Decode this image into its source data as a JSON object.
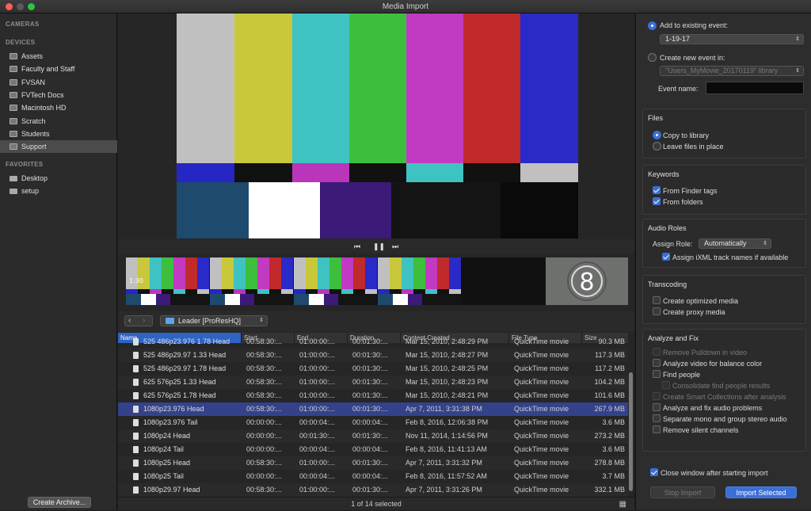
{
  "window": {
    "title": "Media Import"
  },
  "sidebar": {
    "sections": {
      "cameras": "CAMERAS",
      "devices": "DEVICES",
      "favorites": "FAVORITES"
    },
    "devices": [
      {
        "label": "Assets",
        "icon": "drive-icon"
      },
      {
        "label": "Faculty and Staff",
        "icon": "drive-icon"
      },
      {
        "label": "FVSAN",
        "icon": "drive-icon"
      },
      {
        "label": "FVTech Docs",
        "icon": "drive-icon"
      },
      {
        "label": "Macintosh HD",
        "icon": "drive-icon"
      },
      {
        "label": "Scratch",
        "icon": "drive-icon"
      },
      {
        "label": "Students",
        "icon": "drive-icon"
      },
      {
        "label": "Support",
        "icon": "drive-icon",
        "selected": true
      }
    ],
    "favorites": [
      {
        "label": "Desktop",
        "icon": "folder-icon"
      },
      {
        "label": "setup",
        "icon": "folder-icon"
      }
    ],
    "create_archive": "Create Archive..."
  },
  "viewer": {
    "filmstrip_timecode": "1:30",
    "countdown_number": "8"
  },
  "browser": {
    "folder": "Leader [ProResHQ]",
    "columns": [
      "Name",
      "Start",
      "End",
      "Duration",
      "Content Created",
      "File Type",
      "Size"
    ],
    "rows": [
      {
        "name": "525 486p23.976 1.78 Head",
        "start": "00:58:30:...",
        "end": "01:00:00:...",
        "duration": "00:01:30:...",
        "created": "Mar 15, 2010, 2:48:29 PM",
        "type": "QuickTime movie",
        "size": "90.3 MB"
      },
      {
        "name": "525 486p29.97 1.33 Head",
        "start": "00:58:30:...",
        "end": "01:00:00:...",
        "duration": "00:01:30:...",
        "created": "Mar 15, 2010, 2:48:27 PM",
        "type": "QuickTime movie",
        "size": "117.3 MB"
      },
      {
        "name": "525 486p29.97 1.78 Head",
        "start": "00:58:30:...",
        "end": "01:00:00:...",
        "duration": "00:01:30:...",
        "created": "Mar 15, 2010, 2:48:25 PM",
        "type": "QuickTime movie",
        "size": "117.2 MB"
      },
      {
        "name": "625 576p25 1.33 Head",
        "start": "00:58:30:...",
        "end": "01:00:00:...",
        "duration": "00:01:30:...",
        "created": "Mar 15, 2010, 2:48:23 PM",
        "type": "QuickTime movie",
        "size": "104.2 MB"
      },
      {
        "name": "625 576p25 1.78 Head",
        "start": "00:58:30:...",
        "end": "01:00:00:...",
        "duration": "00:01:30:...",
        "created": "Mar 15, 2010, 2:48:21 PM",
        "type": "QuickTime movie",
        "size": "101.6 MB"
      },
      {
        "name": "1080p23.976 Head",
        "start": "00:58:30:...",
        "end": "01:00:00:...",
        "duration": "00:01:30:...",
        "created": "Apr 7, 2011, 3:31:38 PM",
        "type": "QuickTime movie",
        "size": "267.9 MB",
        "selected": true
      },
      {
        "name": "1080p23.976 Tail",
        "start": "00:00:00:...",
        "end": "00:00:04:...",
        "duration": "00:00:04:...",
        "created": "Feb 8, 2016, 12:06:38 PM",
        "type": "QuickTime movie",
        "size": "3.6 MB"
      },
      {
        "name": "1080p24 Head",
        "start": "00:00:00:...",
        "end": "00:01:30:...",
        "duration": "00:01:30:...",
        "created": "Nov 11, 2014, 1:14:56 PM",
        "type": "QuickTime movie",
        "size": "273.2 MB"
      },
      {
        "name": "1080p24 Tail",
        "start": "00:00:00:...",
        "end": "00:00:04:...",
        "duration": "00:00:04:...",
        "created": "Feb 8, 2016, 11:41:13 AM",
        "type": "QuickTime movie",
        "size": "3.6 MB"
      },
      {
        "name": "1080p25 Head",
        "start": "00:58:30:...",
        "end": "01:00:00:...",
        "duration": "00:01:30:...",
        "created": "Apr 7, 2011, 3:31:32 PM",
        "type": "QuickTime movie",
        "size": "278.8 MB"
      },
      {
        "name": "1080p25 Tail",
        "start": "00:00:00:...",
        "end": "00:00:04:...",
        "duration": "00:00:04:...",
        "created": "Feb 8, 2016, 11:57:52 AM",
        "type": "QuickTime movie",
        "size": "3.7 MB"
      },
      {
        "name": "1080p29.97 Head",
        "start": "00:58:30:...",
        "end": "01:00:00:...",
        "duration": "00:01:30:...",
        "created": "Apr 7, 2011, 3:31:26 PM",
        "type": "QuickTime movie",
        "size": "332.1 MB"
      }
    ],
    "status": "1 of 14 selected"
  },
  "options": {
    "event": {
      "add_existing_label": "Add to existing event:",
      "existing_event": "1-19-17",
      "create_new_label": "Create new event in:",
      "library": "\"Users_MyMovie_20170119\" library",
      "event_name_label": "Event name:"
    },
    "files": {
      "title": "Files",
      "copy": "Copy to library",
      "leave": "Leave files in place"
    },
    "keywords": {
      "title": "Keywords",
      "finder_tags": "From Finder tags",
      "folders": "From folders"
    },
    "audio_roles": {
      "title": "Audio Roles",
      "assign_label": "Assign Role:",
      "role": "Automatically",
      "ixml": "Assign iXML track names if available"
    },
    "transcoding": {
      "title": "Transcoding",
      "optimized": "Create optimized media",
      "proxy": "Create proxy media"
    },
    "analyze": {
      "title": "Analyze and Fix",
      "pulldown": "Remove Pulldown in video",
      "balance": "Analyze video for balance color",
      "people": "Find people",
      "consolidate": "Consolidate find people results",
      "smart": "Create Smart Collections after analysis",
      "audio": "Analyze and fix audio problems",
      "mono": "Separate mono and group stereo audio",
      "silent": "Remove silent channels"
    },
    "close_window": "Close window after starting import",
    "stop_import": "Stop Import",
    "import_selected": "Import Selected"
  }
}
